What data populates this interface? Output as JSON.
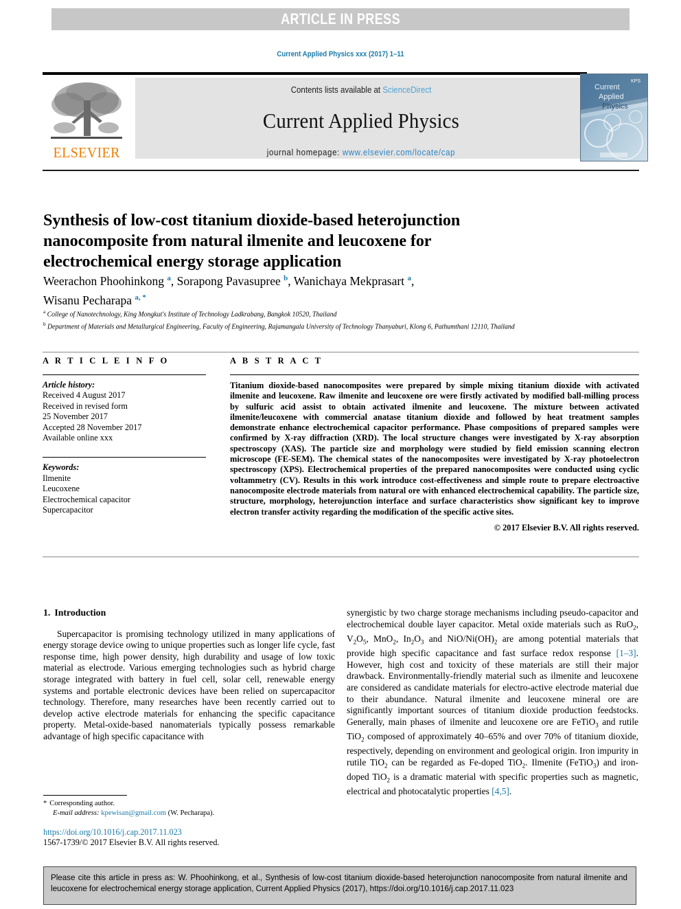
{
  "banner": {
    "text": "ARTICLE IN PRESS"
  },
  "running_head": {
    "text": "Current Applied Physics xxx (2017) 1–11"
  },
  "masthead": {
    "publisher_name": "ELSEVIER",
    "publisher_logo_icon": "elsevier-tree-logo",
    "contents_prefix": "Contents lists available at ",
    "contents_link": "ScienceDirect",
    "journal_name": "Current Applied Physics",
    "homepage_prefix": "journal homepage: ",
    "homepage_url": "www.elsevier.com/locate/cap",
    "cover_title_line1": "Current",
    "cover_title_line2": "Applied",
    "cover_title_line3": "Physics",
    "cover_badge": "KPS"
  },
  "article": {
    "title": "Synthesis of low-cost titanium dioxide-based heterojunction nanocomposite from natural ilmenite and leucoxene for electrochemical energy storage application",
    "authors": [
      {
        "name": "Weerachon Phoohinkong",
        "marks": "a",
        "sep": ", "
      },
      {
        "name": "Sorapong Pavasupree",
        "marks": "b",
        "sep": ", "
      },
      {
        "name": "Wanichaya Mekprasart",
        "marks": "a",
        "sep": ", "
      },
      {
        "name": "Wisanu Pecharapa",
        "marks": "a, *",
        "sep": ""
      }
    ],
    "affiliations": [
      {
        "mark": "a",
        "text": "College of Nanotechnology, King Mongkut's Institute of Technology Ladkrabang, Bangkok 10520, Thailand"
      },
      {
        "mark": "b",
        "text": "Department of Materials and Metallurgical Engineering, Faculty of Engineering, Rajamangala University of Technology Thanyaburi, Klong 6, Pathumthani 12110, Thailand"
      }
    ]
  },
  "article_info": {
    "heading": "A R T I C L E   I N F O",
    "history_label": "Article history:",
    "history": [
      "Received 4 August 2017",
      "Received in revised form",
      "25 November 2017",
      "Accepted 28 November 2017",
      "Available online xxx"
    ],
    "keywords_label": "Keywords:",
    "keywords": [
      "Ilmenite",
      "Leucoxene",
      "Electrochemical capacitor",
      "Supercapacitor"
    ]
  },
  "abstract": {
    "heading": "A B S T R A C T",
    "text": "Titanium dioxide-based nanocomposites were prepared by simple mixing titanium dioxide with activated ilmenite and leucoxene. Raw ilmenite and leucoxene ore were firstly activated by modified ball-milling process by sulfuric acid assist to obtain activated ilmenite and leucoxene. The mixture between activated ilmenite/leucoxene with commercial anatase titanium dioxide and followed by heat treatment samples demonstrate enhance electrochemical capacitor performance. Phase compositions of prepared samples were confirmed by X-ray diffraction (XRD). The local structure changes were investigated by X-ray absorption spectroscopy (XAS). The particle size and morphology were studied by field emission scanning electron microscope (FE-SEM). The chemical states of the nanocomposites were investigated by X-ray photoelectron spectroscopy (XPS). Electrochemical properties of the prepared nanocomposites were conducted using cyclic voltammetry (CV). Results in this work introduce cost-effectiveness and simple route to prepare electroactive nanocomposite electrode materials from natural ore with enhanced electrochemical capability. The particle size, structure, morphology, heterojunction interface and surface characteristics show significant key to improve electron transfer activity regarding the modification of the specific active sites.",
    "copyright": "© 2017 Elsevier B.V. All rights reserved."
  },
  "introduction": {
    "number": "1.",
    "heading": "Introduction",
    "left_paragraph": "Supercapacitor is promising technology utilized in many applications of energy storage device owing to unique properties such as longer life cycle, fast response time, high power density, high durability and usage of low toxic material as electrode. Various emerging technologies such as hybrid charge storage integrated with battery in fuel cell, solar cell, renewable energy systems and portable electronic devices have been relied on supercapacitor technology. Therefore, many researches have been recently carried out to develop active electrode materials for enhancing the specific capacitance property. Metal-oxide-based nanomaterials typically possess remarkable advantage of high specific capacitance with"
  },
  "footnote": {
    "star": "*",
    "corresponding": "Corresponding author.",
    "email_label": "E-mail address:",
    "email": "kpewisan@gmail.com",
    "email_owner": "(W. Pecharapa)."
  },
  "doi": {
    "link": "https://doi.org/10.1016/j.cap.2017.11.023",
    "issn_line": "1567-1739/© 2017 Elsevier B.V. All rights reserved."
  },
  "cite_box": {
    "text": "Please cite this article in press as: W. Phoohinkong, et al., Synthesis of low-cost titanium dioxide-based heterojunction nanocomposite from natural ilmenite and leucoxene for electrochemical energy storage application, Current Applied Physics (2017), https://doi.org/10.1016/j.cap.2017.11.023"
  },
  "colors": {
    "link_blue": "#1a7aa8",
    "elsevier_orange": "#f07d00",
    "banner_gray": "#c7c7c7",
    "band_gray": "#e3e3e3"
  }
}
